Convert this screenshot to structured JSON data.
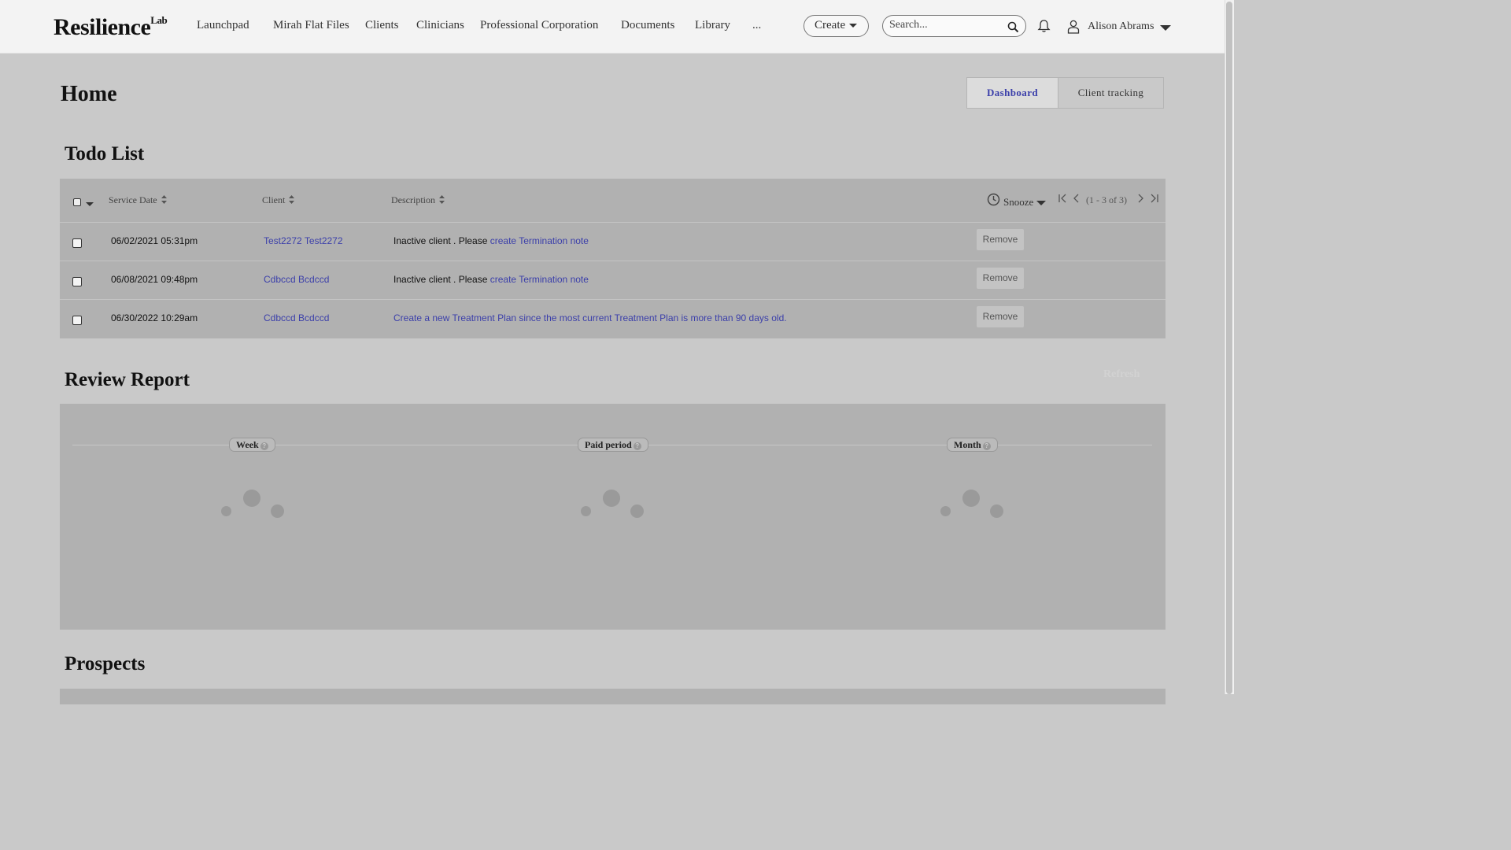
{
  "nav": {
    "logo": "Resilience",
    "logo_sup": "Lab",
    "items": [
      "Launchpad",
      "Mirah Flat Files",
      "Clients",
      "Clinicians",
      "Professional Corporation",
      "Documents",
      "Library",
      "..."
    ],
    "create_label": "Create",
    "search_placeholder": "Search...",
    "user_name": "Alison Abrams"
  },
  "header": {
    "title": "Home",
    "tabs": [
      {
        "label": "Dashboard",
        "active": true
      },
      {
        "label": "Client tracking",
        "active": false
      }
    ]
  },
  "todo": {
    "title": "Todo List",
    "columns": [
      "Service Date",
      "Client",
      "Description"
    ],
    "snooze_label": "Snooze",
    "pager_text": "(1 - 3 of 3)",
    "rows": [
      {
        "date": "06/02/2021 05:31pm",
        "client": "Test2272 Test2272",
        "desc_prefix": "Inactive client . Please ",
        "desc_link": "create Termination note",
        "action": "Remove"
      },
      {
        "date": "06/08/2021 09:48pm",
        "client": "Cdbccd Bcdccd",
        "desc_prefix": "Inactive client . Please ",
        "desc_link": "create Termination note",
        "action": "Remove"
      },
      {
        "date": "06/30/2022 10:29am",
        "client": "Cdbccd Bcdccd",
        "desc_prefix": "",
        "desc_link": "Create a new Treatment Plan since the most current Treatment Plan is more than 90 days old.",
        "action": "Remove"
      }
    ]
  },
  "review": {
    "title": "Review Report",
    "refresh_label": "Refresh",
    "periods": [
      "Week",
      "Paid period",
      "Month"
    ]
  },
  "prospects": {
    "title": "Prospects"
  },
  "colors": {
    "link": "#3b3faa",
    "panel": "#b1b1b1",
    "background": "#c9c9c9"
  }
}
